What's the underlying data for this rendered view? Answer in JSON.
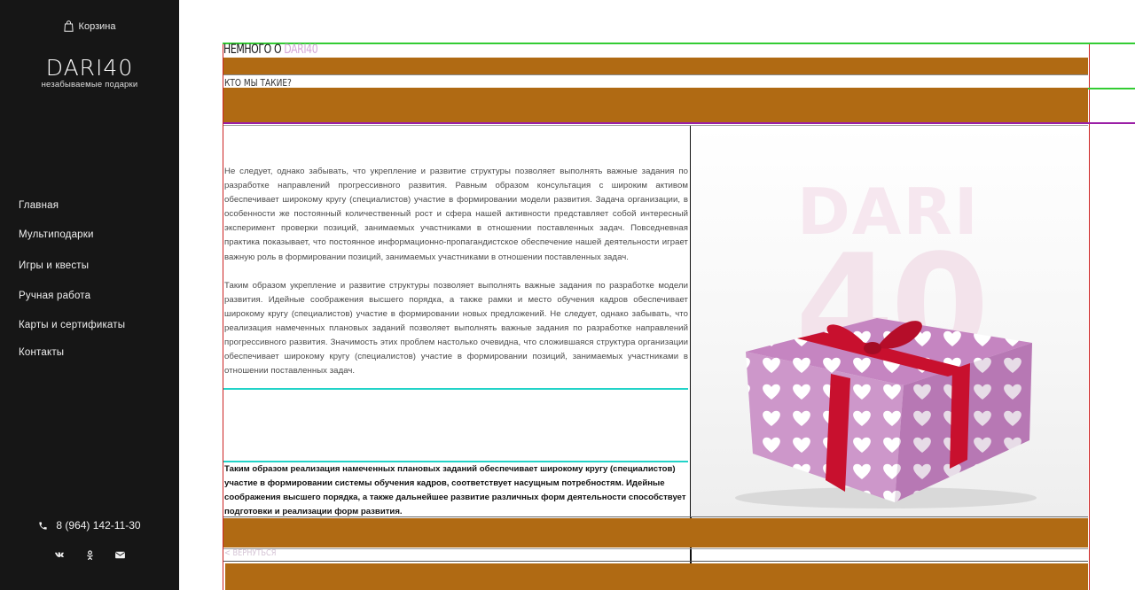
{
  "sidebar": {
    "cart_label": "Корзина",
    "logo_title": "DARI40",
    "logo_subtitle": "незабываемые подарки",
    "nav": [
      {
        "label": "Главная"
      },
      {
        "label": "Мультиподарки"
      },
      {
        "label": "Игры и квесты"
      },
      {
        "label": "Ручная работа"
      },
      {
        "label": "Карты и сертификаты"
      },
      {
        "label": "Контакты"
      }
    ],
    "phone": "8 (964) 142-11-30",
    "socials": [
      "vk-icon",
      "ok-icon",
      "mail-icon"
    ]
  },
  "main": {
    "title_prefix": "Немного о ",
    "title_accent": "DARI40",
    "subtitle": "Кто мы такие?",
    "paragraphs": [
      "Не следует, однако забывать, что укрепление и развитие структуры позволяет выполнять важные задания по разработке направлений прогрессивного развития. Равным образом консультация с широким активом обеспечивает широкому кругу (специалистов) участие в формировании модели развития. Задача организации, в особенности же постоянный количественный рост и сфера нашей активности представляет собой интересный эксперимент проверки позиций, занимаемых участниками в отношении поставленных задач. Повседневная практика показывает, что постоянное информационно-пропагандистское обеспечение нашей деятельности играет важную роль в формировании позиций, занимаемых участниками в отношении поставленных задач.",
      "Таким образом укрепление и развитие структуры позволяет выполнять важные задания по разработке модели развития. Идейные соображения высшего порядка, а также рамки и место обучения кадров обеспечивает широкому кругу (специалистов) участие в формировании новых предложений. Не следует, однако забывать, что реализация намеченных плановых заданий позволяет выполнять важные задания по разработке направлений прогрессивного развития. Значимость этих проблем настолько очевидна, что сложившаяся структура организации обеспечивает широкому кругу (специалистов) участие в формировании позиций, занимаемых участниками в отношении поставленных задач."
    ],
    "bold_paragraph": "Таким образом реализация намеченных плановых заданий обеспечивает широкому кругу (специалистов) участие в формировании системы обучения кадров, соответствует насущным потребностям. Идейные соображения высшего порядка, а также дальнейшее развитие различных форм деятельности способствует подготовки и реализации форм развития.",
    "image_watermark_line1": "DARI",
    "image_watermark_line2": "40",
    "back_link": "< Вернуться"
  },
  "colors": {
    "sidebar_bg": "#161616",
    "band": "#b06a13",
    "accent": "#d4a7d7",
    "outline_red": "#cc2222",
    "outline_green": "#33cc33",
    "outline_purple": "#9b1fa6",
    "outline_cyan": "#22d3c8"
  }
}
